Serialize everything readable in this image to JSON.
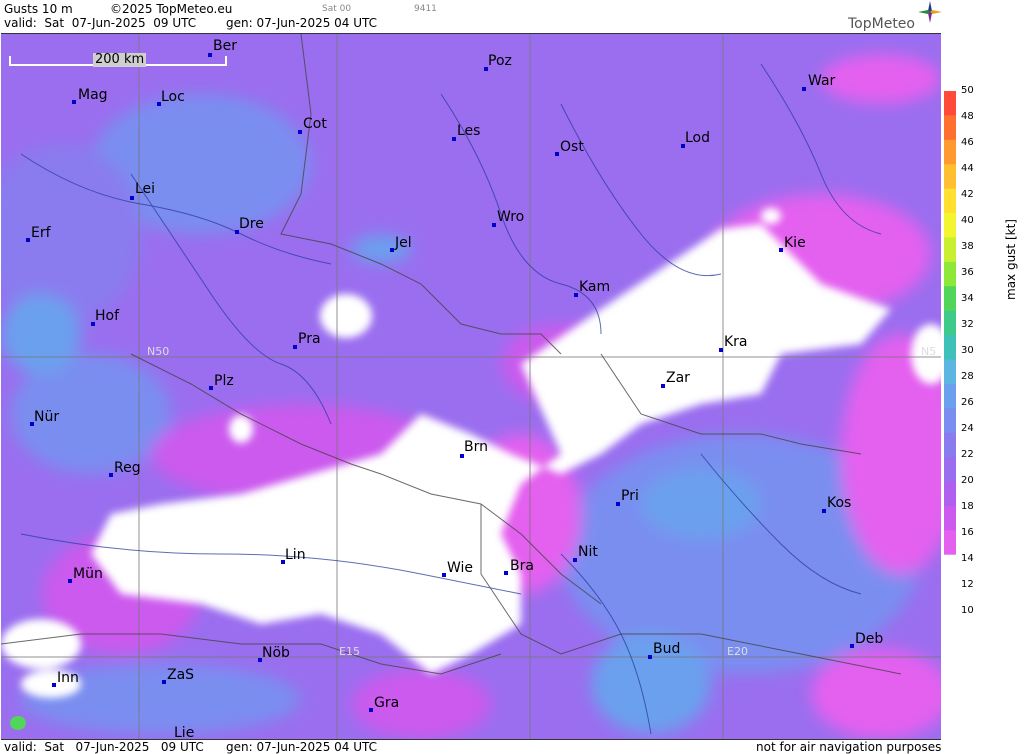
{
  "header": {
    "title": "Gusts 10 m",
    "copyright": "©2025 TopMeteo.eu",
    "valid": "valid:  Sat  07-Jun-2025  09 UTC",
    "gen": "gen: 07-Jun-2025 04 UTC",
    "sat": "Sat 00",
    "code": "9411",
    "logo": "TopMeteo"
  },
  "footer": {
    "valid": "valid:  Sat   07-Jun-2025   09 UTC",
    "gen": "gen: 07-Jun-2025 04 UTC",
    "disclaimer": "not for air navigation purposes"
  },
  "scale": {
    "label": "200 km"
  },
  "grid_labels": {
    "n50_left": "N50",
    "n50_right": "N5",
    "e15": "E15",
    "e20": "E20"
  },
  "legend": {
    "title": "max  gust  [kt]",
    "ticks": [
      "50",
      "48",
      "46",
      "44",
      "42",
      "40",
      "38",
      "36",
      "34",
      "32",
      "30",
      "28",
      "26",
      "24",
      "22",
      "20",
      "18",
      "16",
      "14",
      "12",
      "10"
    ],
    "colors": [
      "#ff4a3a",
      "#ff7030",
      "#ff9a30",
      "#ffbf30",
      "#ffe030",
      "#f2f530",
      "#c8f030",
      "#8ee83a",
      "#52d65a",
      "#3fca8a",
      "#3fc0b8",
      "#5cb6e0",
      "#6aa0ee",
      "#7a8ef0",
      "#8a7cef",
      "#9a6eef",
      "#b060ef",
      "#cc5aee",
      "#e460ef",
      "#ffffff"
    ]
  },
  "cities": [
    {
      "name": "Ber"
    },
    {
      "name": "Poz"
    },
    {
      "name": "War"
    },
    {
      "name": "Mag"
    },
    {
      "name": "Loc"
    },
    {
      "name": "Cot"
    },
    {
      "name": "Les"
    },
    {
      "name": "Ost"
    },
    {
      "name": "Lod"
    },
    {
      "name": "Lei"
    },
    {
      "name": "Dre"
    },
    {
      "name": "Wro"
    },
    {
      "name": "Erf"
    },
    {
      "name": "Jel"
    },
    {
      "name": "Kie"
    },
    {
      "name": "Kam"
    },
    {
      "name": "Hof"
    },
    {
      "name": "Pra"
    },
    {
      "name": "Kra"
    },
    {
      "name": "Plz"
    },
    {
      "name": "Zar"
    },
    {
      "name": "Nür"
    },
    {
      "name": "Brn"
    },
    {
      "name": "Reg"
    },
    {
      "name": "Pri"
    },
    {
      "name": "Kos"
    },
    {
      "name": "Lin"
    },
    {
      "name": "Nit"
    },
    {
      "name": "Wie"
    },
    {
      "name": "Bra"
    },
    {
      "name": "Mün"
    },
    {
      "name": "Bud"
    },
    {
      "name": "Deb"
    },
    {
      "name": "Nöb"
    },
    {
      "name": "Inn"
    },
    {
      "name": "ZaS"
    },
    {
      "name": "Gra"
    },
    {
      "name": "Lie"
    }
  ]
}
